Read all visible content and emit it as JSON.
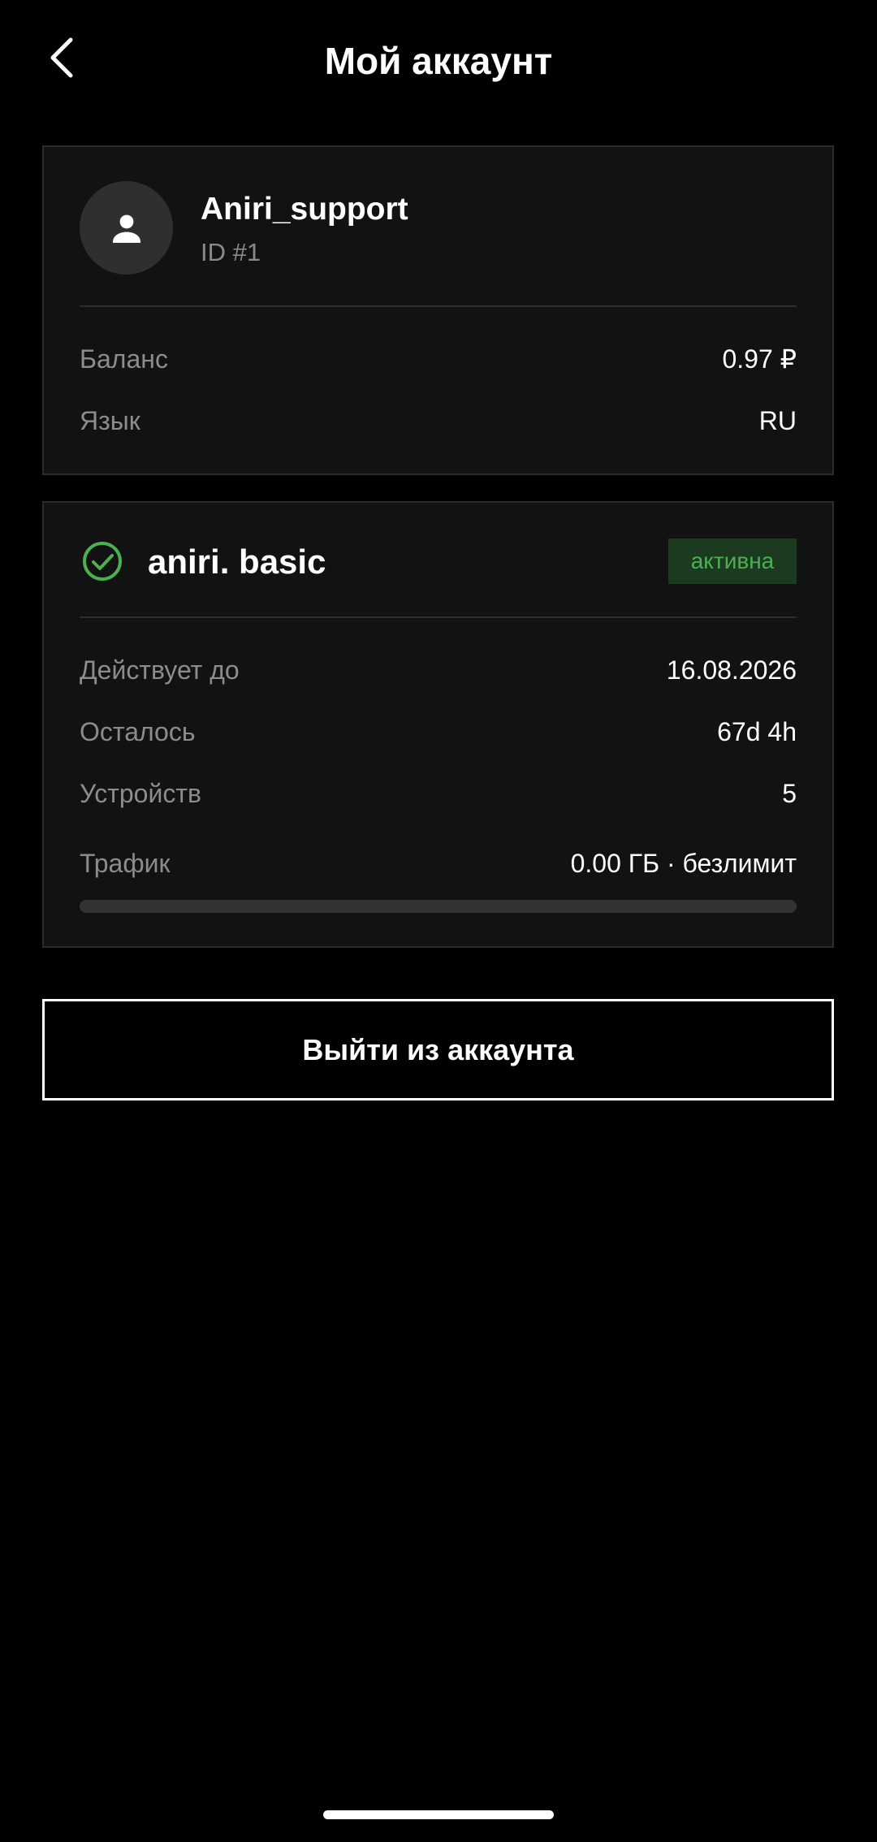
{
  "header": {
    "title": "Мой аккаунт",
    "back_icon": "chevron-left-icon"
  },
  "profile": {
    "avatar_icon": "person-icon",
    "username": "Aniri_support",
    "user_id": "ID #1",
    "rows": [
      {
        "label": "Баланс",
        "value": "0.97 ₽"
      },
      {
        "label": "Язык",
        "value": "RU"
      }
    ]
  },
  "subscription": {
    "status_icon": "check-circle-icon",
    "plan_name": "aniri. basic",
    "status_badge": "активна",
    "rows": [
      {
        "label": "Действует до",
        "value": "16.08.2026"
      },
      {
        "label": "Осталось",
        "value": "67d 4h"
      },
      {
        "label": "Устройств",
        "value": "5"
      },
      {
        "label": "Трафик",
        "value": "0.00 ГБ · безлимит"
      }
    ],
    "traffic_progress": 0
  },
  "logout_button": "Выйти из аккаунта",
  "colors": {
    "background": "#000000",
    "card": "#121212",
    "accent_green": "#4caf50",
    "badge_bg": "#1c3a1f",
    "muted_text": "#8c8c8c"
  }
}
